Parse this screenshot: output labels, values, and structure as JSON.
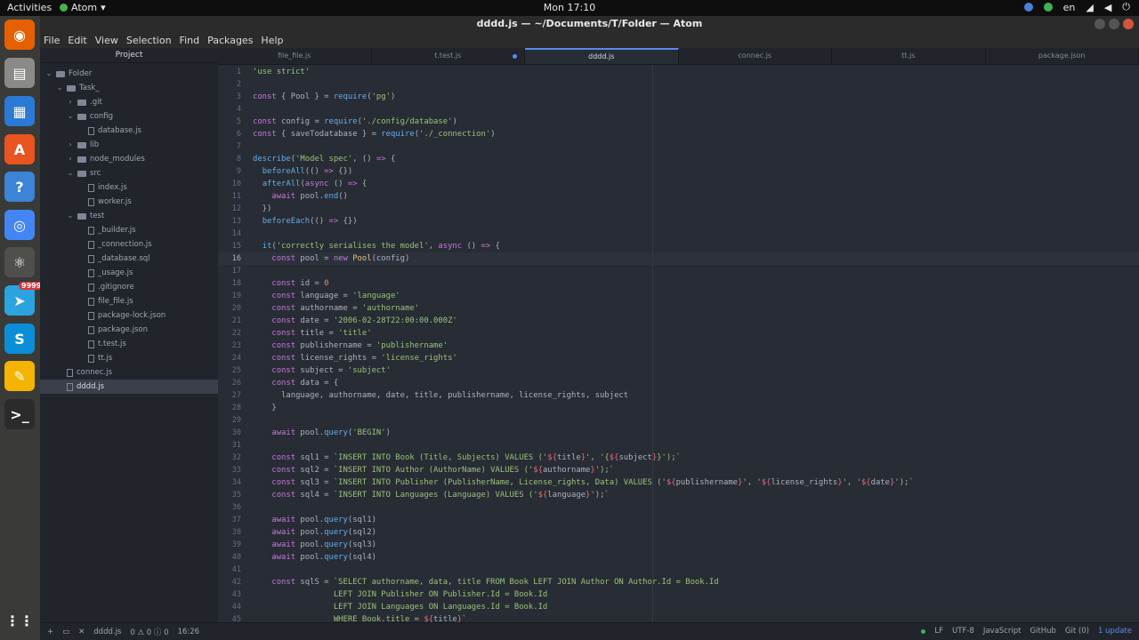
{
  "topbar": {
    "activities": "Activities",
    "app": "Atom",
    "clock": "Mon 17:10",
    "lang": "en"
  },
  "window": {
    "title": "dddd.js — ~/Documents/T/Folder — Atom"
  },
  "menu": [
    "File",
    "Edit",
    "View",
    "Selection",
    "Find",
    "Packages",
    "Help"
  ],
  "dock": {
    "badge": "9999",
    "icons": [
      "firefox-icon",
      "files-icon",
      "writer-icon",
      "software-icon",
      "help-icon",
      "chrome-icon",
      "atom-icon",
      "telegram-icon",
      "skype-icon",
      "text-editor-icon",
      "terminal-icon",
      "apps-grid-icon"
    ]
  },
  "tree": {
    "header": "Project",
    "items": [
      {
        "label": "Folder",
        "type": "dir",
        "depth": 0,
        "open": true
      },
      {
        "label": "Task_",
        "type": "dir",
        "depth": 1,
        "open": true
      },
      {
        "label": ".git",
        "type": "dir",
        "depth": 2,
        "open": false
      },
      {
        "label": "config",
        "type": "dir",
        "depth": 2,
        "open": true
      },
      {
        "label": "database.js",
        "type": "file",
        "depth": 3
      },
      {
        "label": "lib",
        "type": "dir",
        "depth": 2,
        "open": false
      },
      {
        "label": "node_modules",
        "type": "dir",
        "depth": 2,
        "open": false
      },
      {
        "label": "src",
        "type": "dir",
        "depth": 2,
        "open": true
      },
      {
        "label": "index.js",
        "type": "file",
        "depth": 3
      },
      {
        "label": "worker.js",
        "type": "file",
        "depth": 3
      },
      {
        "label": "test",
        "type": "dir",
        "depth": 2,
        "open": true
      },
      {
        "label": "_builder.js",
        "type": "file",
        "depth": 3
      },
      {
        "label": "_connection.js",
        "type": "file",
        "depth": 3
      },
      {
        "label": "_database.sql",
        "type": "file",
        "depth": 3
      },
      {
        "label": "_usage.js",
        "type": "file",
        "depth": 3
      },
      {
        "label": ".gitignore",
        "type": "file",
        "depth": 3
      },
      {
        "label": "file_file.js",
        "type": "file",
        "depth": 3
      },
      {
        "label": "package-lock.json",
        "type": "file",
        "depth": 3
      },
      {
        "label": "package.json",
        "type": "file",
        "depth": 3
      },
      {
        "label": "t.test.js",
        "type": "file",
        "depth": 3
      },
      {
        "label": "tt.js",
        "type": "file",
        "depth": 3
      },
      {
        "label": "connec.js",
        "type": "file",
        "depth": 1
      },
      {
        "label": "dddd.js",
        "type": "file",
        "depth": 1,
        "selected": true
      }
    ]
  },
  "tabs": [
    {
      "label": "file_file.js"
    },
    {
      "label": "t.test.js",
      "modified": true
    },
    {
      "label": "dddd.js",
      "active": true
    },
    {
      "label": "connec.js"
    },
    {
      "label": "tt.js"
    },
    {
      "label": "package.json"
    }
  ],
  "editor": {
    "current_line": 16,
    "lines": [
      [
        [
          "s",
          "'use strict'"
        ]
      ],
      [],
      [
        [
          "k",
          "const"
        ],
        [
          "t",
          " { Pool } = "
        ],
        [
          "f",
          "require"
        ],
        [
          "t",
          "("
        ],
        [
          "s",
          "'pg'"
        ],
        [
          "t",
          ")"
        ]
      ],
      [],
      [
        [
          "k",
          "const"
        ],
        [
          "t",
          " config = "
        ],
        [
          "f",
          "require"
        ],
        [
          "t",
          "("
        ],
        [
          "s",
          "'./config/database'"
        ],
        [
          "t",
          ")"
        ]
      ],
      [
        [
          "k",
          "const"
        ],
        [
          "t",
          " { saveTodatabase } = "
        ],
        [
          "f",
          "require"
        ],
        [
          "t",
          "("
        ],
        [
          "s",
          "'./_connection'"
        ],
        [
          "t",
          ")"
        ]
      ],
      [],
      [
        [
          "f",
          "describe"
        ],
        [
          "t",
          "("
        ],
        [
          "s",
          "'Model spec'"
        ],
        [
          "t",
          ", () "
        ],
        [
          "k",
          "=>"
        ],
        [
          "t",
          " {"
        ]
      ],
      [
        [
          "t",
          "  "
        ],
        [
          "f",
          "beforeAll"
        ],
        [
          "t",
          "(() "
        ],
        [
          "k",
          "=>"
        ],
        [
          "t",
          " {})"
        ]
      ],
      [
        [
          "t",
          "  "
        ],
        [
          "f",
          "afterAll"
        ],
        [
          "t",
          "("
        ],
        [
          "k",
          "async"
        ],
        [
          "t",
          " () "
        ],
        [
          "k",
          "=>"
        ],
        [
          "t",
          " {"
        ]
      ],
      [
        [
          "t",
          "    "
        ],
        [
          "k",
          "await"
        ],
        [
          "t",
          " pool."
        ],
        [
          "f",
          "end"
        ],
        [
          "t",
          "()"
        ]
      ],
      [
        [
          "t",
          "  })"
        ]
      ],
      [
        [
          "t",
          "  "
        ],
        [
          "f",
          "beforeEach"
        ],
        [
          "t",
          "(() "
        ],
        [
          "k",
          "=>"
        ],
        [
          "t",
          " {})"
        ]
      ],
      [],
      [
        [
          "t",
          "  "
        ],
        [
          "f",
          "it"
        ],
        [
          "t",
          "("
        ],
        [
          "s",
          "'correctly serialises the model'"
        ],
        [
          "t",
          ", "
        ],
        [
          "k",
          "async"
        ],
        [
          "t",
          " () "
        ],
        [
          "k",
          "=>"
        ],
        [
          "t",
          " {"
        ]
      ],
      [
        [
          "t",
          "    "
        ],
        [
          "k",
          "const"
        ],
        [
          "t",
          " pool = "
        ],
        [
          "k",
          "new"
        ],
        [
          "t",
          " "
        ],
        [
          "c",
          "Pool"
        ],
        [
          "t",
          "(config)"
        ]
      ],
      [],
      [
        [
          "t",
          "    "
        ],
        [
          "k",
          "const"
        ],
        [
          "t",
          " id = "
        ],
        [
          "n",
          "0"
        ]
      ],
      [
        [
          "t",
          "    "
        ],
        [
          "k",
          "const"
        ],
        [
          "t",
          " language = "
        ],
        [
          "s",
          "'language'"
        ]
      ],
      [
        [
          "t",
          "    "
        ],
        [
          "k",
          "const"
        ],
        [
          "t",
          " authorname = "
        ],
        [
          "s",
          "'authorname'"
        ]
      ],
      [
        [
          "t",
          "    "
        ],
        [
          "k",
          "const"
        ],
        [
          "t",
          " date = "
        ],
        [
          "s",
          "'2006-02-28T22:00:00.000Z'"
        ]
      ],
      [
        [
          "t",
          "    "
        ],
        [
          "k",
          "const"
        ],
        [
          "t",
          " title = "
        ],
        [
          "s",
          "'title'"
        ]
      ],
      [
        [
          "t",
          "    "
        ],
        [
          "k",
          "const"
        ],
        [
          "t",
          " publishername = "
        ],
        [
          "s",
          "'publishername'"
        ]
      ],
      [
        [
          "t",
          "    "
        ],
        [
          "k",
          "const"
        ],
        [
          "t",
          " license_rights = "
        ],
        [
          "s",
          "'license_rights'"
        ]
      ],
      [
        [
          "t",
          "    "
        ],
        [
          "k",
          "const"
        ],
        [
          "t",
          " subject = "
        ],
        [
          "s",
          "'subject'"
        ]
      ],
      [
        [
          "t",
          "    "
        ],
        [
          "k",
          "const"
        ],
        [
          "t",
          " data = {"
        ]
      ],
      [
        [
          "t",
          "      language, authorname, date, title, publishername, license_rights, subject"
        ]
      ],
      [
        [
          "t",
          "    }"
        ]
      ],
      [],
      [
        [
          "t",
          "    "
        ],
        [
          "k",
          "await"
        ],
        [
          "t",
          " pool."
        ],
        [
          "f",
          "query"
        ],
        [
          "t",
          "("
        ],
        [
          "s",
          "'BEGIN'"
        ],
        [
          "t",
          ")"
        ]
      ],
      [],
      [
        [
          "t",
          "    "
        ],
        [
          "k",
          "const"
        ],
        [
          "t",
          " sql1 = "
        ],
        [
          "s",
          "`INSERT INTO Book (Title, Subjects) VALUES ('"
        ],
        [
          "v",
          "${"
        ],
        [
          "t",
          "title"
        ],
        [
          "v",
          "}"
        ],
        [
          "s",
          "', '{"
        ],
        [
          "v",
          "${"
        ],
        [
          "t",
          "subject"
        ],
        [
          "v",
          "}"
        ],
        [
          "s",
          "}');`"
        ]
      ],
      [
        [
          "t",
          "    "
        ],
        [
          "k",
          "const"
        ],
        [
          "t",
          " sql2 = "
        ],
        [
          "s",
          "`INSERT INTO Author (AuthorName) VALUES ('"
        ],
        [
          "v",
          "${"
        ],
        [
          "t",
          "authorname"
        ],
        [
          "v",
          "}"
        ],
        [
          "s",
          "');`"
        ]
      ],
      [
        [
          "t",
          "    "
        ],
        [
          "k",
          "const"
        ],
        [
          "t",
          " sql3 = "
        ],
        [
          "s",
          "`INSERT INTO Publisher (PublisherName, License_rights, Data) VALUES ('"
        ],
        [
          "v",
          "${"
        ],
        [
          "t",
          "publishername"
        ],
        [
          "v",
          "}"
        ],
        [
          "s",
          "', '"
        ],
        [
          "v",
          "${"
        ],
        [
          "t",
          "license_rights"
        ],
        [
          "v",
          "}"
        ],
        [
          "s",
          "', '"
        ],
        [
          "v",
          "${"
        ],
        [
          "t",
          "date"
        ],
        [
          "v",
          "}"
        ],
        [
          "s",
          "');`"
        ]
      ],
      [
        [
          "t",
          "    "
        ],
        [
          "k",
          "const"
        ],
        [
          "t",
          " sql4 = "
        ],
        [
          "s",
          "`INSERT INTO Languages (Language) VALUES ('"
        ],
        [
          "v",
          "${"
        ],
        [
          "t",
          "language"
        ],
        [
          "v",
          "}"
        ],
        [
          "s",
          "');`"
        ]
      ],
      [],
      [
        [
          "t",
          "    "
        ],
        [
          "k",
          "await"
        ],
        [
          "t",
          " pool."
        ],
        [
          "f",
          "query"
        ],
        [
          "t",
          "(sql1)"
        ]
      ],
      [
        [
          "t",
          "    "
        ],
        [
          "k",
          "await"
        ],
        [
          "t",
          " pool."
        ],
        [
          "f",
          "query"
        ],
        [
          "t",
          "(sql2)"
        ]
      ],
      [
        [
          "t",
          "    "
        ],
        [
          "k",
          "await"
        ],
        [
          "t",
          " pool."
        ],
        [
          "f",
          "query"
        ],
        [
          "t",
          "(sql3)"
        ]
      ],
      [
        [
          "t",
          "    "
        ],
        [
          "k",
          "await"
        ],
        [
          "t",
          " pool."
        ],
        [
          "f",
          "query"
        ],
        [
          "t",
          "(sql4)"
        ]
      ],
      [],
      [
        [
          "t",
          "    "
        ],
        [
          "k",
          "const"
        ],
        [
          "t",
          " sqlS = "
        ],
        [
          "s",
          "`SELECT authorname, data, title FROM Book LEFT JOIN Author ON Author.Id = Book.Id"
        ]
      ],
      [
        [
          "s",
          "                 LEFT JOIN Publisher ON Publisher.Id = Book.Id"
        ]
      ],
      [
        [
          "s",
          "                 LEFT JOIN Languages ON Languages.Id = Book.Id"
        ]
      ],
      [
        [
          "s",
          "                 WHERE Book.title = "
        ],
        [
          "v",
          "${"
        ],
        [
          "t",
          "title"
        ],
        [
          "v",
          "}"
        ],
        [
          "s",
          "`"
        ]
      ]
    ]
  },
  "status": {
    "file": "dddd.js",
    "diagnostics": "0 ⚠ 0 ⓘ 0",
    "cursor": "16:26",
    "line_ending": "LF",
    "encoding": "UTF-8",
    "grammar": "JavaScript",
    "github": "GitHub",
    "git": "Git (0)",
    "update": "1 update"
  }
}
